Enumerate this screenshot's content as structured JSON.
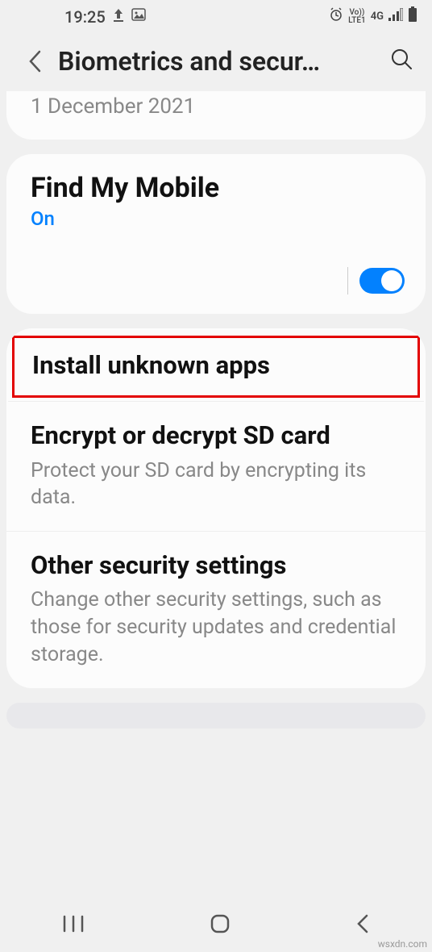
{
  "statusBar": {
    "time": "19:25",
    "netLabel1": "Vo))",
    "netLabel2": "LTE1",
    "netLabel3": "4G"
  },
  "header": {
    "title": "Biometrics and secur…"
  },
  "dateCard": {
    "date": "1 December 2021"
  },
  "findMobile": {
    "title": "Find My Mobile",
    "status": "On"
  },
  "items": {
    "install": {
      "title": "Install unknown apps"
    },
    "encrypt": {
      "title": "Encrypt or decrypt SD card",
      "subtitle": "Protect your SD card by encrypting its data."
    },
    "other": {
      "title": "Other security settings",
      "subtitle": "Change other security settings, such as those for security updates and credential storage."
    }
  },
  "watermark": "wsxdn.com"
}
